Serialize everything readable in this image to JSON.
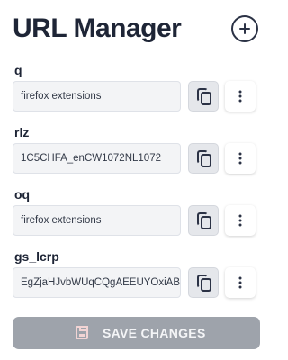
{
  "header": {
    "title": "URL Manager",
    "add_icon": "plus-circle-icon"
  },
  "params": [
    {
      "key": "q",
      "value": "firefox extensions"
    },
    {
      "key": "rlz",
      "value": "1C5CHFA_enCW1072NL1072"
    },
    {
      "key": "oq",
      "value": "firefox extensions"
    },
    {
      "key": "gs_lcrp",
      "value": "EgZjaHJvbWUqCQgAEEUYOxiABD"
    }
  ],
  "icons": {
    "copy": "copy-icon",
    "more": "kebab-menu-icon",
    "save": "floppy-disk-icon"
  },
  "footer": {
    "save_label": "SAVE CHANGES"
  },
  "colors": {
    "text": "#1e2536",
    "field_bg": "#f3f4f6",
    "copy_button_bg": "#e5e7eb",
    "save_button_bg": "#9ea3ab",
    "save_icon": "#f2d4d4"
  }
}
